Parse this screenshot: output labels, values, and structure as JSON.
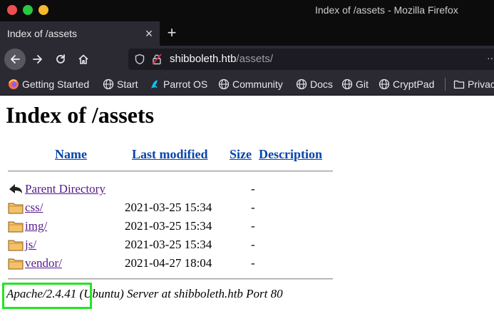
{
  "window": {
    "title": "Index of /assets - Mozilla Firefox",
    "colors": {
      "close": "#ee4f4f",
      "maximize": "#28c840",
      "minimize": "#f5b82e"
    }
  },
  "tab": {
    "title": "Index of /assets",
    "close_label": "×",
    "new_tab_label": "+"
  },
  "urlbar": {
    "host": "shibboleth.htb",
    "path": "/assets/",
    "overflow_label": "··"
  },
  "bookmarks": [
    {
      "label": "Getting Started",
      "icon": "firefox-icon"
    },
    {
      "label": "Start",
      "icon": "globe-icon"
    },
    {
      "label": "Parrot OS",
      "icon": "parrot-icon"
    },
    {
      "label": "Community",
      "icon": "globe-icon"
    },
    {
      "label": "Docs",
      "icon": "globe-icon"
    },
    {
      "label": "Git",
      "icon": "globe-icon"
    },
    {
      "label": "CryptPad",
      "icon": "globe-icon"
    },
    {
      "label": "Privac",
      "icon": "folder-icon"
    }
  ],
  "page": {
    "heading": "Index of /assets",
    "columns": {
      "name": "Name",
      "last_modified": "Last modified",
      "size": "Size",
      "description": "Description"
    },
    "parent": {
      "label": "Parent Directory",
      "size": "-",
      "icon": "back-arrow-icon"
    },
    "entries": [
      {
        "name": "css/",
        "modified": "2021-03-25 15:34",
        "size": "-",
        "icon": "folder-icon"
      },
      {
        "name": "img/",
        "modified": "2021-03-25 15:34",
        "size": "-",
        "icon": "folder-icon"
      },
      {
        "name": "js/",
        "modified": "2021-03-25 15:34",
        "size": "-",
        "icon": "folder-icon"
      },
      {
        "name": "vendor/",
        "modified": "2021-04-27 18:04",
        "size": "-",
        "icon": "folder-icon"
      }
    ],
    "server_signature": {
      "software": "Apache/2.4.41",
      "rest": " (Ubuntu) Server at shibboleth.htb Port 80"
    },
    "highlight_color": "#23e623"
  }
}
